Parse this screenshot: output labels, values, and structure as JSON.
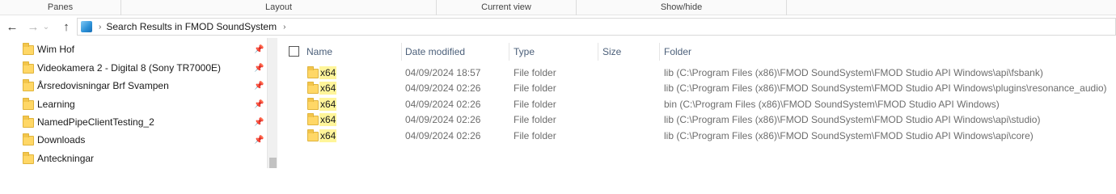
{
  "ribbon": {
    "groups": [
      "Panes",
      "Layout",
      "Current view",
      "Show/hide"
    ]
  },
  "address": {
    "separator": "›",
    "path": "Search Results in FMOD SoundSystem"
  },
  "nav": {
    "back": "←",
    "forward": "→",
    "up": "↑",
    "recent": "⌄"
  },
  "navpane": {
    "items": [
      {
        "label": "Wim Hof",
        "pinned": true
      },
      {
        "label": "Videokamera 2 - Digital 8  (Sony TR7000E)",
        "pinned": true
      },
      {
        "label": "Årsredovisningar Brf Svampen",
        "pinned": true
      },
      {
        "label": "Learning",
        "pinned": true
      },
      {
        "label": "NamedPipeClientTesting_2",
        "pinned": true
      },
      {
        "label": "Downloads",
        "pinned": true
      },
      {
        "label": "Anteckningar",
        "pinned": false
      }
    ],
    "pin_glyph": "📌"
  },
  "columns": {
    "name": "Name",
    "date": "Date modified",
    "type": "Type",
    "size": "Size",
    "folder": "Folder"
  },
  "rows": [
    {
      "name": "x64",
      "date": "04/09/2024 18:57",
      "type": "File folder",
      "size": "",
      "folder": "lib (C:\\Program Files (x86)\\FMOD SoundSystem\\FMOD Studio API Windows\\api\\fsbank)"
    },
    {
      "name": "x64",
      "date": "04/09/2024 02:26",
      "type": "File folder",
      "size": "",
      "folder": "lib (C:\\Program Files (x86)\\FMOD SoundSystem\\FMOD Studio API Windows\\plugins\\resonance_audio)"
    },
    {
      "name": "x64",
      "date": "04/09/2024 02:26",
      "type": "File folder",
      "size": "",
      "folder": "bin (C:\\Program Files (x86)\\FMOD SoundSystem\\FMOD Studio API Windows)"
    },
    {
      "name": "x64",
      "date": "04/09/2024 02:26",
      "type": "File folder",
      "size": "",
      "folder": "lib (C:\\Program Files (x86)\\FMOD SoundSystem\\FMOD Studio API Windows\\api\\studio)"
    },
    {
      "name": "x64",
      "date": "04/09/2024 02:26",
      "type": "File folder",
      "size": "",
      "folder": "lib (C:\\Program Files (x86)\\FMOD SoundSystem\\FMOD Studio API Windows\\api\\core)"
    }
  ],
  "colors": {
    "search_highlight": "#fff59a",
    "folder_yellow": "#ffd766",
    "header_text": "#4c607a"
  }
}
